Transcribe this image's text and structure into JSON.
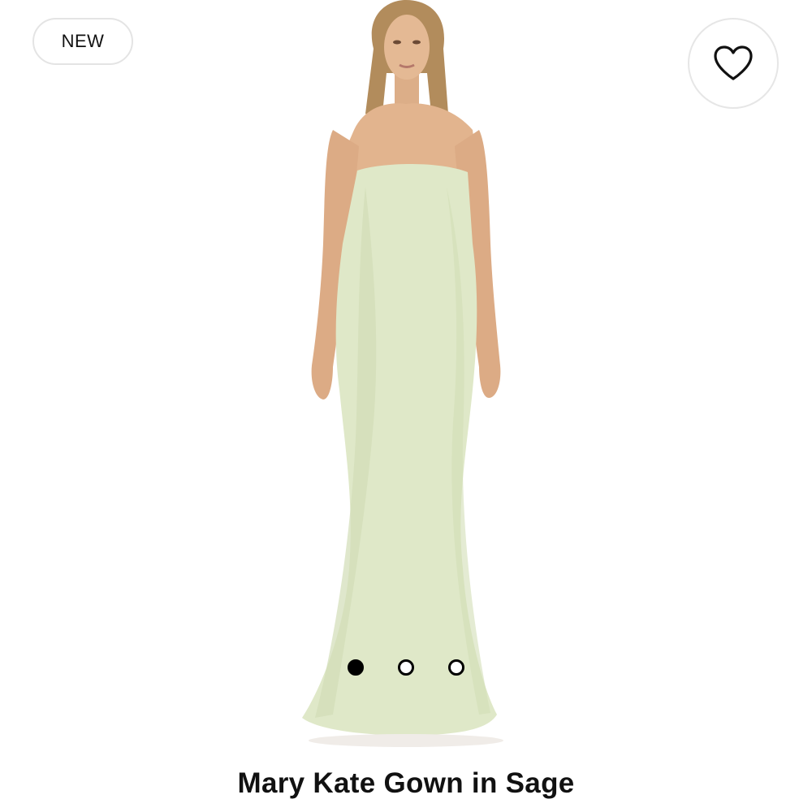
{
  "badge": {
    "label": "NEW"
  },
  "favorite": {
    "icon": "heart-outline-icon"
  },
  "product": {
    "name": "Mary Kate Gown in Sage",
    "dress_color": "#dfe8c8",
    "skin_color": "#e2b48e",
    "hair_color": "#b28c5c"
  },
  "carousel": {
    "count": 3,
    "active_index": 0
  }
}
